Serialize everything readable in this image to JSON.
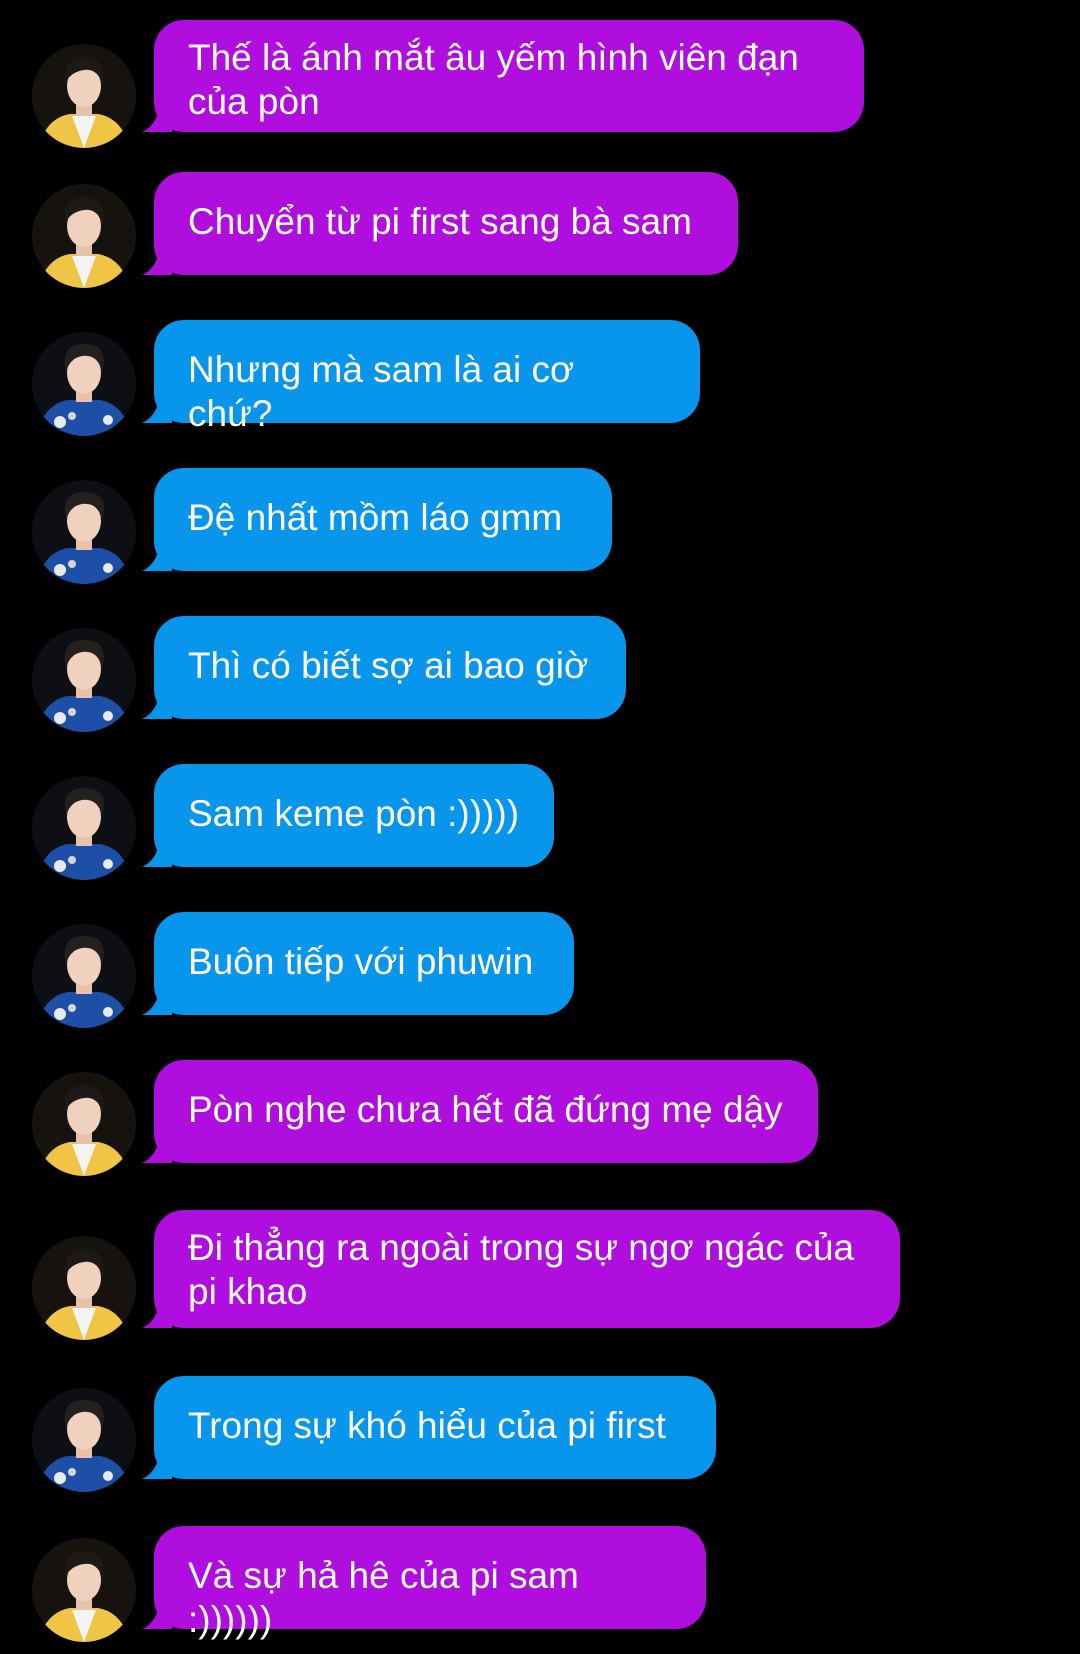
{
  "colors": {
    "background": "#000000",
    "purple_bubble": "#b00ddf",
    "blue_bubble": "#0895ec",
    "text": "#ffffff"
  },
  "messages": [
    {
      "sender": "yellow-jacket-avatar",
      "bubble": "purple",
      "text": "Thế là ánh mắt âu yếm hình viên đạn của pòn"
    },
    {
      "sender": "yellow-jacket-avatar",
      "bubble": "purple",
      "text": "Chuyển từ pi first sang bà sam"
    },
    {
      "sender": "blue-shirt-avatar",
      "bubble": "blue",
      "text": "Nhưng mà sam là ai cơ chứ?"
    },
    {
      "sender": "blue-shirt-avatar",
      "bubble": "blue",
      "text": "Đệ nhất mồm láo gmm"
    },
    {
      "sender": "blue-shirt-avatar",
      "bubble": "blue",
      "text": "Thì có biết sợ ai bao giờ"
    },
    {
      "sender": "blue-shirt-avatar",
      "bubble": "blue",
      "text": "Sam keme pòn :)))))"
    },
    {
      "sender": "blue-shirt-avatar",
      "bubble": "blue",
      "text": "Buôn tiếp với phuwin"
    },
    {
      "sender": "yellow-jacket-avatar",
      "bubble": "purple",
      "text": "Pòn nghe chưa hết đã đứng mẹ dậy"
    },
    {
      "sender": "yellow-jacket-avatar",
      "bubble": "purple",
      "text": "Đi thẳng ra ngoài trong sự ngơ ngác của pi khao"
    },
    {
      "sender": "blue-shirt-avatar",
      "bubble": "blue",
      "text": "Trong sự khó hiểu của pi first"
    },
    {
      "sender": "yellow-jacket-avatar",
      "bubble": "purple",
      "text": "Và sự hả hê của pi sam :))))))"
    }
  ]
}
